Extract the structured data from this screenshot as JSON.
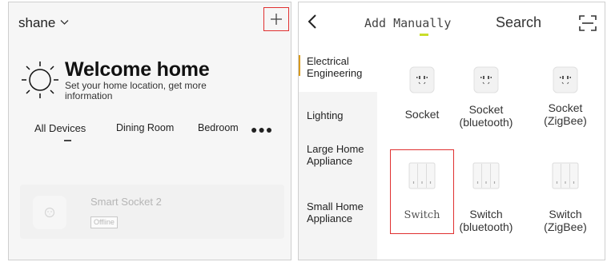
{
  "left": {
    "home_name": "shane",
    "welcome_title": "Welcome home",
    "welcome_subtitle": "Set your home location, get more information",
    "rooms": [
      "All Devices",
      "Dining Room",
      "Bedroom"
    ],
    "more_label": "●●●",
    "device": {
      "name": "Smart Socket 2",
      "status": "Offline"
    }
  },
  "right": {
    "title": "Add Manually",
    "search_label": "Search",
    "categories": [
      {
        "label": "Electrical Engineering"
      },
      {
        "label": "Lighting"
      },
      {
        "label": "Large Home Appliance"
      },
      {
        "label": "Small Home Appliance"
      }
    ],
    "items": [
      {
        "label": "Socket",
        "icon": "socket-icon"
      },
      {
        "label": "Socket (bluetooth)",
        "icon": "socket-bluetooth-icon"
      },
      {
        "label": "Socket (ZigBee)",
        "icon": "socket-zigbee-icon"
      },
      {
        "label": "Switch",
        "icon": "switch-icon"
      },
      {
        "label": "Switch (bluetooth)",
        "icon": "switch-bluetooth-icon"
      },
      {
        "label": "Switch (ZigBee)",
        "icon": "switch-zigbee-icon"
      }
    ],
    "accent_color": "#d89a1e",
    "tab_indicator_color": "#c9dd2a",
    "highlight_color": "#e03030"
  }
}
